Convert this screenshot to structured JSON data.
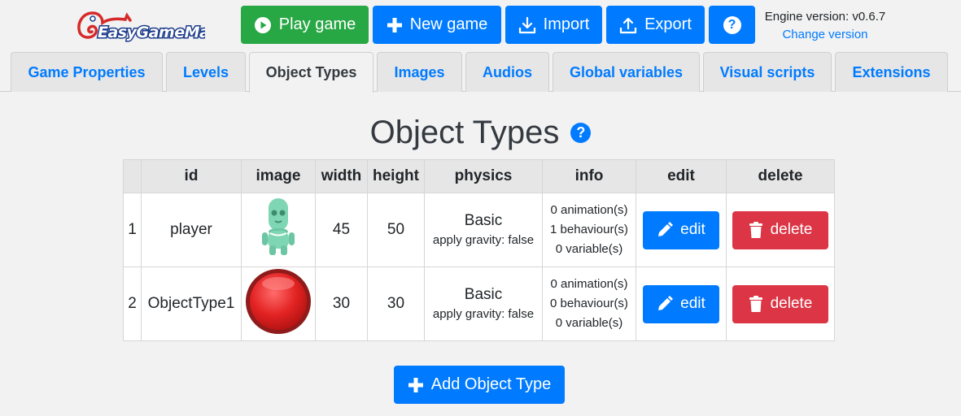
{
  "app": {
    "logo_text": "EasyGameMaker",
    "engine_label": "Engine version: v0.6.7",
    "change_version": "Change version"
  },
  "toolbar": {
    "play_label": "Play game",
    "new_label": "New game",
    "import_label": "Import",
    "export_label": "Export",
    "help_label": "?"
  },
  "tabs": [
    {
      "label": "Game Properties",
      "active": false
    },
    {
      "label": "Levels",
      "active": false
    },
    {
      "label": "Object Types",
      "active": true
    },
    {
      "label": "Images",
      "active": false
    },
    {
      "label": "Audios",
      "active": false
    },
    {
      "label": "Global variables",
      "active": false
    },
    {
      "label": "Visual scripts",
      "active": false
    },
    {
      "label": "Extensions",
      "active": false
    }
  ],
  "page": {
    "title": "Object Types",
    "help_label": "?"
  },
  "table": {
    "headers": [
      "",
      "id",
      "image",
      "width",
      "height",
      "physics",
      "info",
      "edit",
      "delete"
    ],
    "rows": [
      {
        "index": "1",
        "id": "player",
        "image": "green-alien-sprite",
        "width": "45",
        "height": "50",
        "physics": "Basic",
        "physics_detail": "apply gravity: false",
        "animations": "0 animation(s)",
        "behaviours": "1 behaviour(s)",
        "variables": "0 variable(s)",
        "edit_label": "edit",
        "delete_label": "delete"
      },
      {
        "index": "2",
        "id": "ObjectType1",
        "image": "red-ball-sprite",
        "width": "30",
        "height": "30",
        "physics": "Basic",
        "physics_detail": "apply gravity: false",
        "animations": "0 animation(s)",
        "behaviours": "0 behaviour(s)",
        "variables": "0 variable(s)",
        "edit_label": "edit",
        "delete_label": "delete"
      }
    ]
  },
  "add_button_label": "Add Object Type",
  "colors": {
    "primary": "#007bff",
    "success": "#28a745",
    "danger": "#dc3545",
    "background": "#f2f2f2"
  }
}
